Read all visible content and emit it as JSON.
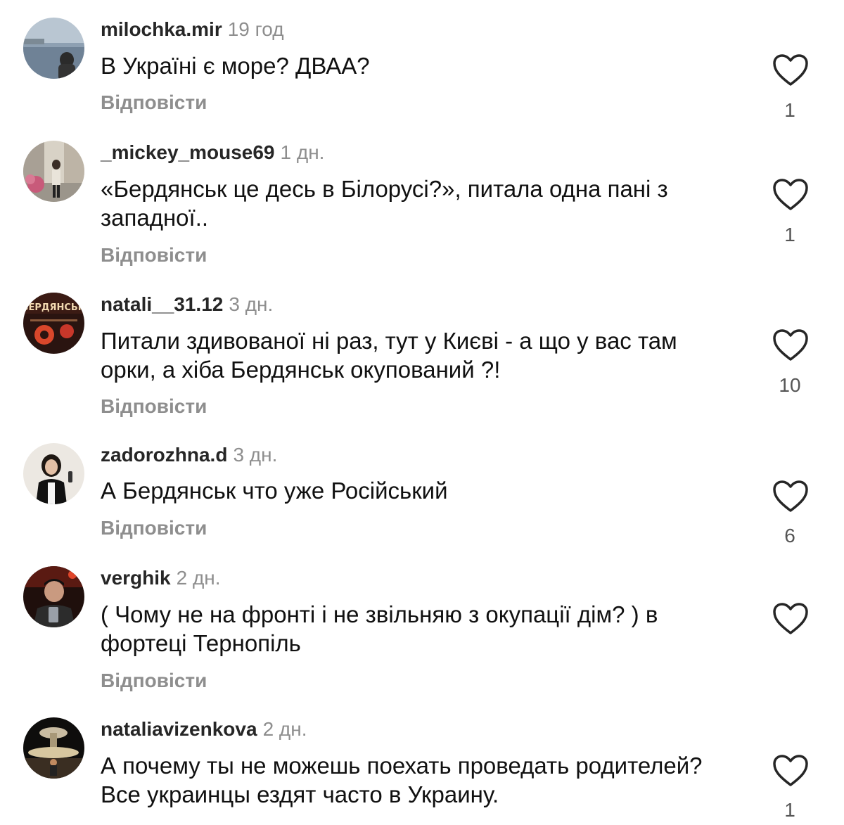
{
  "reply_label": "Відповісти",
  "comments": [
    {
      "username": "milochka.mir",
      "time": "19 год",
      "text": "В Україні є море? ДВАА?",
      "likes": "1",
      "avatar_icon": "avatar-sea-photo"
    },
    {
      "username": "_mickey_mouse69",
      "time": "1 дн.",
      "text": "«Бердянськ це десь в Білорусі?», питала одна пані з западної..",
      "likes": "1",
      "avatar_icon": "avatar-street-photo"
    },
    {
      "username": "natali__31.12",
      "time": "3 дн.",
      "text": "Питали здивованої ні раз, тут у Києві - а що у вас там орки, а хіба Бердянськ окупований ?!",
      "likes": "10",
      "avatar_icon": "avatar-berdiansk-poster"
    },
    {
      "username": "zadorozhna.d",
      "time": "3 дн.",
      "text": "А Бердянськ что уже Російський",
      "likes": "6",
      "avatar_icon": "avatar-portrait-photo"
    },
    {
      "username": "verghik",
      "time": "2 дн.",
      "text": "( Чому не на фронті і не звільняю з окупації дім? ) в фортеці Тернопіль",
      "likes": "",
      "avatar_icon": "avatar-selfie-photo"
    },
    {
      "username": "nataliavizenkova",
      "time": "2 дн.",
      "text": "А почему ты не можешь поехать проведать родителей? Все украинцы ездят часто в Украину.",
      "likes": "1",
      "avatar_icon": "avatar-fountain-photo"
    }
  ],
  "colors": {
    "username": "#262626",
    "secondary": "#8e8e8e",
    "heart_stroke": "#262626"
  },
  "icons": {
    "like": "heart-outline-icon"
  }
}
